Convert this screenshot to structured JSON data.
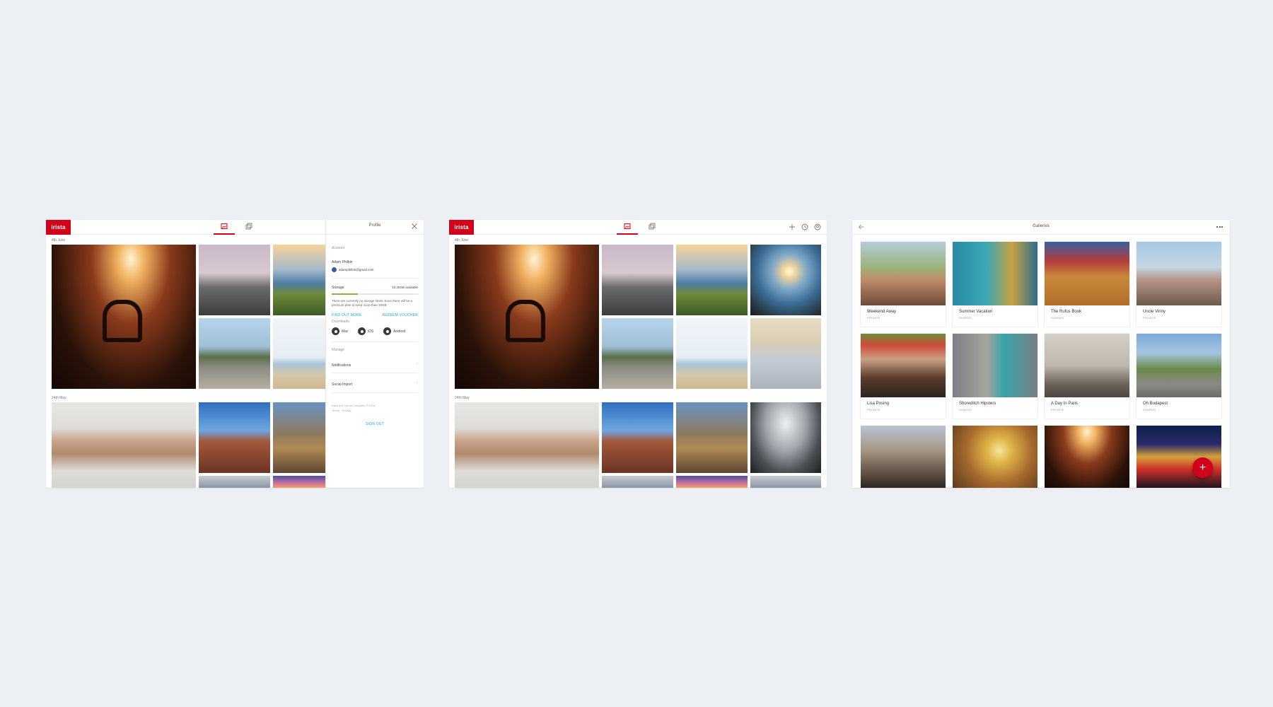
{
  "colors": {
    "brand": "#d0021b",
    "link": "#2aa3d6",
    "storage_fill": "#8bb83a",
    "background": "#eceff3"
  },
  "screen1": {
    "logo": "irista",
    "dates": [
      "4th June",
      "24th May"
    ],
    "profile": {
      "title": "Profile",
      "account_section": "Account",
      "name": "Adam Philbin",
      "email": "adamphilbin@gmail.com",
      "storage_label": "Storage",
      "storage_available": "10.25GB available",
      "storage_fraction": 0.3,
      "storage_note": "There are currently no storage limits. Soon there will be a premium plan to keep more than 15GB.",
      "find_out_more": "FIND OUT MORE",
      "redeem_voucher": "REDEEM VOUCHER",
      "downloads_section": "Downloads",
      "downloads": [
        "Mac",
        "iOS",
        "Android"
      ],
      "manage_section": "Manage",
      "manage_items": [
        "Notifications",
        "Social Import"
      ],
      "footer_company": "Irista is a Canon Company © 2016",
      "footer_links": "Terms · Privacy",
      "sign_out": "SIGN OUT"
    }
  },
  "screen2": {
    "logo": "irista",
    "dates": [
      "4th June",
      "24th May"
    ]
  },
  "screen3": {
    "title": "Galleries",
    "galleries": [
      {
        "name": "Weekend Away",
        "privacy": "PRIVATE"
      },
      {
        "name": "Summer Vacation",
        "privacy": "SHARED"
      },
      {
        "name": "The Rufus Book",
        "privacy": "SHARED"
      },
      {
        "name": "Uncle Vinny",
        "privacy": "PRIVATE"
      },
      {
        "name": "Lisa Posing",
        "privacy": "PRIVATE"
      },
      {
        "name": "Shoreditch Hipsters",
        "privacy": "SHARED"
      },
      {
        "name": "A Day In Paris",
        "privacy": "PRIVATE"
      },
      {
        "name": "Oh Budapest",
        "privacy": "SHARED"
      }
    ],
    "fab": "+"
  }
}
